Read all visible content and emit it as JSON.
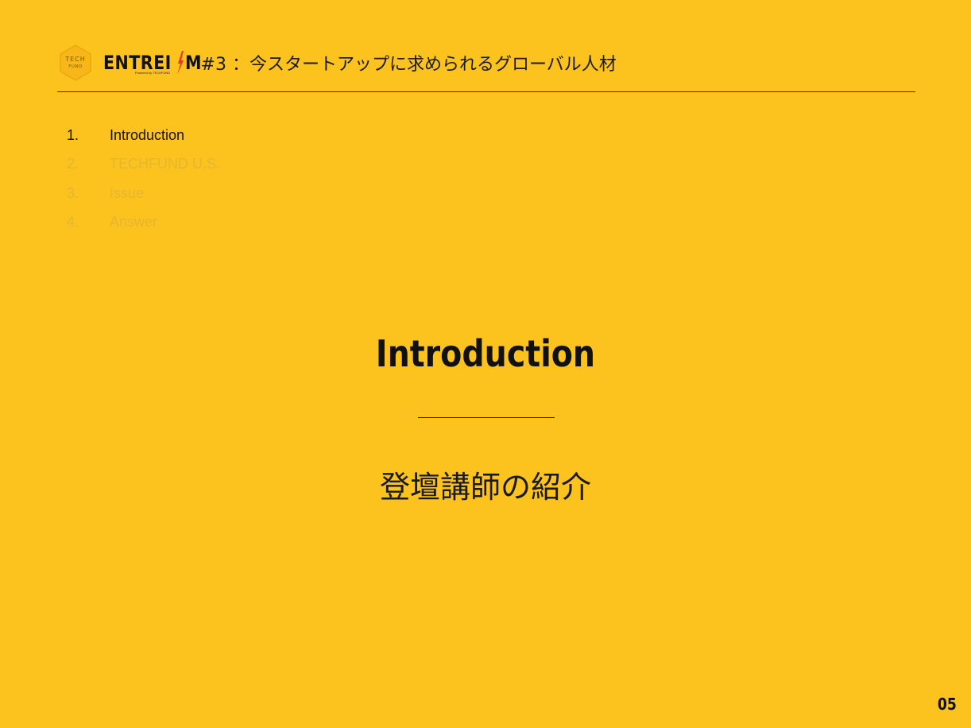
{
  "header": {
    "logo_top": "TECH",
    "logo_bottom": "FUND",
    "brand_word": "ENTREI",
    "brand_last": "M",
    "brand_sub": "Powered by TECHFUND",
    "title": "#3 ：今スタートアップに求められるグローバル人材"
  },
  "agenda": [
    {
      "num": "1.",
      "label": "Introduction",
      "state": "active"
    },
    {
      "num": "2.",
      "label": "TECHFUND U.S.",
      "state": "dim"
    },
    {
      "num": "3.",
      "label": "Issue",
      "state": "dim"
    },
    {
      "num": "4.",
      "label": "Answer",
      "state": "dim"
    }
  ],
  "section": {
    "title": "Introduction",
    "subtitle": "登壇講師の紹介"
  },
  "page_number": "05",
  "colors": {
    "background": "#FCC31E",
    "text": "#111111",
    "dim_text": "#E4B632",
    "bolt": "#E8372A"
  }
}
